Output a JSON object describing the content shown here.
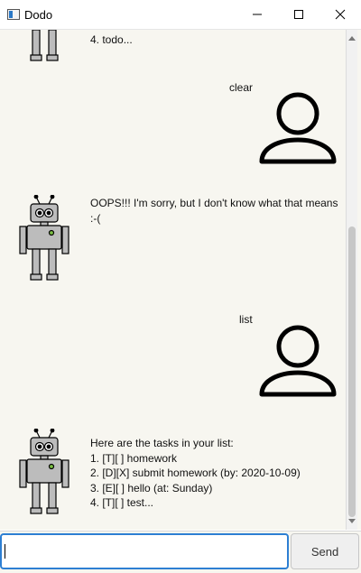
{
  "window": {
    "title": "Dodo"
  },
  "chat": {
    "messages": [
      {
        "sender": "bot",
        "text": "4. todo..."
      },
      {
        "sender": "user",
        "text": "clear"
      },
      {
        "sender": "bot",
        "text": "OOPS!!! I'm sorry, but I don't know what that means\n:-("
      },
      {
        "sender": "user",
        "text": "list"
      },
      {
        "sender": "bot",
        "text": "Here are the tasks in your list:\n1. [T][ ] homework\n2. [D][X] submit homework (by:  2020-10-09)\n3. [E][ ] hello (at:  Sunday)\n4. [T][ ] test..."
      }
    ]
  },
  "input": {
    "value": "",
    "send_label": "Send"
  },
  "colors": {
    "chat_background": "#f7f6f0",
    "accent_focus": "#2d7fd3"
  },
  "icons": {
    "bot": "robot-avatar",
    "user": "user-avatar"
  }
}
